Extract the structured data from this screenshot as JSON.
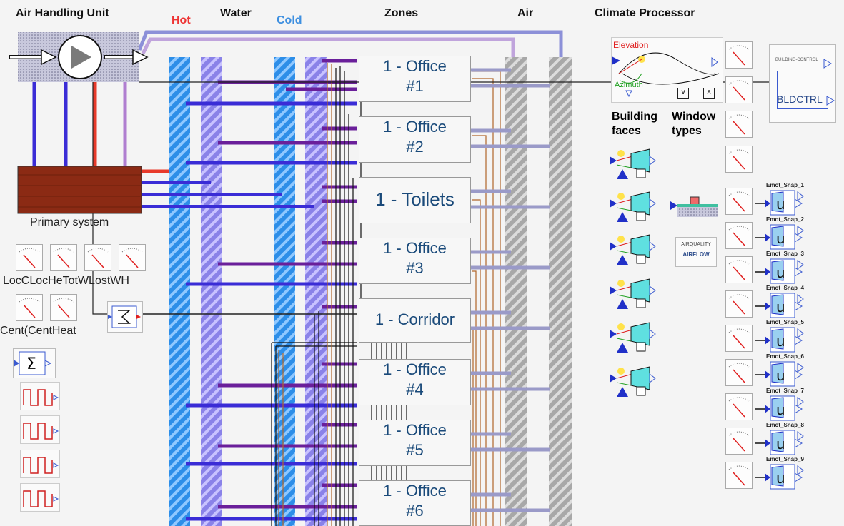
{
  "headers": {
    "ahu": "Air Handling Unit",
    "hot": "Hot",
    "water": "Water",
    "cold": "Cold",
    "zones": "Zones",
    "air": "Air",
    "climate": "Climate Processor"
  },
  "colors": {
    "hot": "#ee3333",
    "cold": "#3d8fe0",
    "hot_pipe": "#4a2bd4",
    "purple": "#6a1f9a",
    "primary": "#8b2a14"
  },
  "zones": [
    {
      "line1": "1 - Office",
      "line2": "#1"
    },
    {
      "line1": "1 - Office",
      "line2": "#2"
    },
    {
      "line1": "1 - Toilets",
      "line2": ""
    },
    {
      "line1": "1 - Office",
      "line2": "#3"
    },
    {
      "line1": "1 - Corridor",
      "line2": ""
    },
    {
      "line1": "1 - Office",
      "line2": "#4"
    },
    {
      "line1": "1 - Office",
      "line2": "#5"
    },
    {
      "line1": "1 - Office",
      "line2": "#6"
    }
  ],
  "primary_system": "Primary system",
  "meters_row1": "LocC​LocHe​TotW​LostWH",
  "meters_row2": "Cent(CentHeat",
  "climate": {
    "elevation": "Elevation",
    "azimuth": "Azimuth",
    "building_faces": "Building faces",
    "window_types": "Window types",
    "bldctrl_small": "BUILDING-CONTROL",
    "bldctrl": "BLDCTRL",
    "airquality": "AIRQUALITY",
    "airflow": "AIRFLOW"
  },
  "emot_snaps": [
    "Emot_Snap_1",
    "Emot_Snap_2",
    "Emot_Snap_3",
    "Emot_Snap_4",
    "Emot_Snap_5",
    "Emot_Snap_6",
    "Emot_Snap_7",
    "Emot_Snap_8",
    "Emot_Snap_9"
  ]
}
